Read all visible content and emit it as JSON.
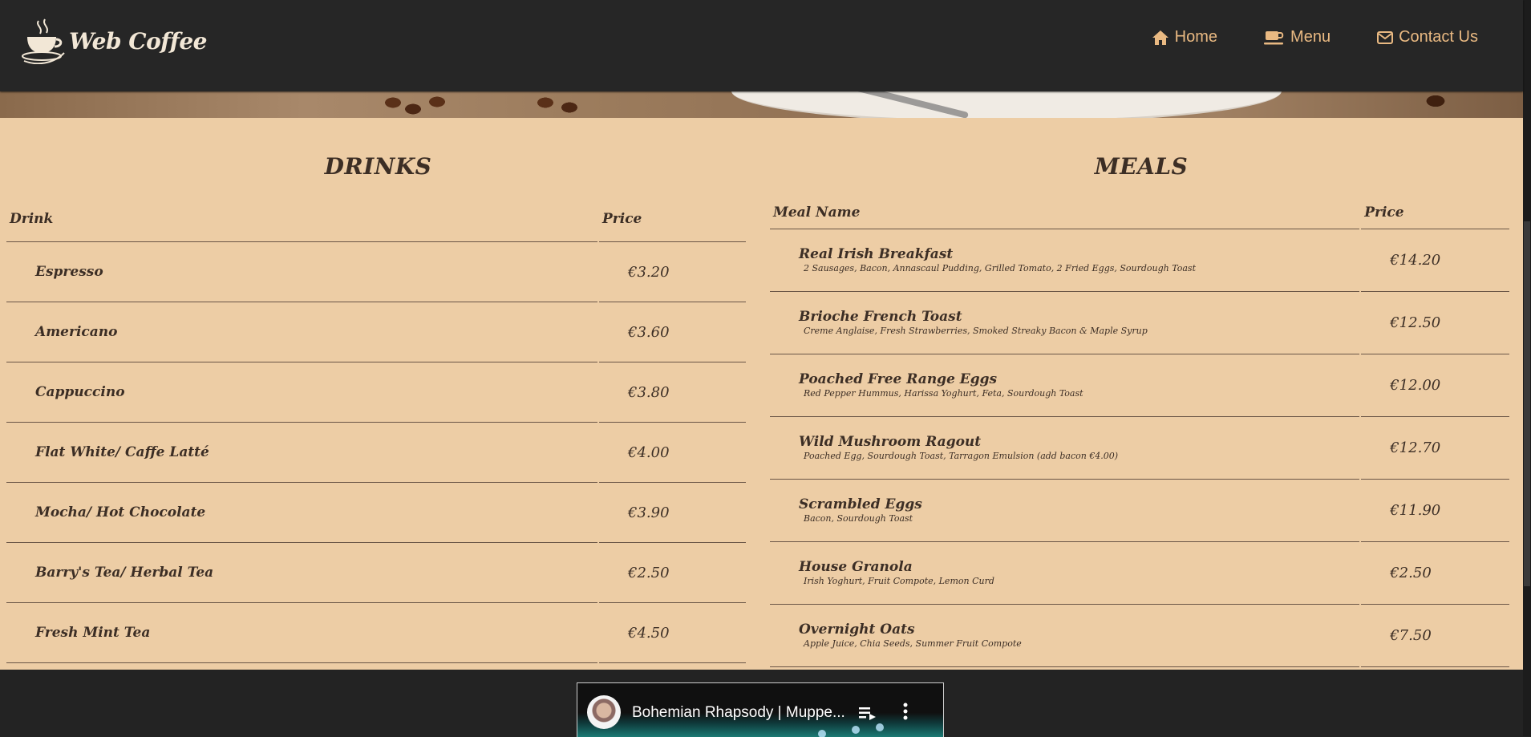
{
  "header": {
    "logo_text": "Web Coffee",
    "logo_icon": "coffee-cup-logo",
    "nav": [
      {
        "label": "Home",
        "icon": "home-icon"
      },
      {
        "label": "Menu",
        "icon": "coffee-cup-icon"
      },
      {
        "label": "Contact Us",
        "icon": "envelope-icon"
      }
    ]
  },
  "drinks": {
    "title": "DRINKS",
    "columns": [
      "Drink",
      "Price"
    ],
    "rows": [
      {
        "name": "Espresso",
        "price": "€3.20"
      },
      {
        "name": "Americano",
        "price": "€3.60"
      },
      {
        "name": "Cappuccino",
        "price": "€3.80"
      },
      {
        "name": "Flat White/ Caffe Latté",
        "price": "€4.00"
      },
      {
        "name": "Mocha/ Hot Chocolate",
        "price": "€3.90"
      },
      {
        "name": "Barry's Tea/ Herbal Tea",
        "price": "€2.50"
      },
      {
        "name": "Fresh Mint Tea",
        "price": "€4.50"
      }
    ]
  },
  "meals": {
    "title": "MEALS",
    "columns": [
      "Meal Name",
      "Price"
    ],
    "rows": [
      {
        "name": "Real Irish Breakfast",
        "desc": "2 Sausages, Bacon, Annascaul Pudding, Grilled Tomato, 2 Fried Eggs, Sourdough Toast",
        "price": "€14.20"
      },
      {
        "name": "Brioche French Toast",
        "desc": "Creme Anglaise, Fresh Strawberries, Smoked Streaky Bacon & Maple Syrup",
        "price": "€12.50"
      },
      {
        "name": "Poached Free Range Eggs",
        "desc": "Red Pepper Hummus, Harissa Yoghurt, Feta, Sourdough Toast",
        "price": "€12.00"
      },
      {
        "name": "Wild Mushroom Ragout",
        "desc": "Poached Egg, Sourdough Toast, Tarragon Emulsion (add bacon €4.00)",
        "price": "€12.70"
      },
      {
        "name": "Scrambled Eggs",
        "desc": "Bacon, Sourdough Toast",
        "price": "€11.90"
      },
      {
        "name": "House Granola",
        "desc": "Irish Yoghurt, Fruit Compote, Lemon Curd",
        "price": "€2.50"
      },
      {
        "name": "Overnight Oats",
        "desc": "Apple Juice, Chia Seeds, Summer Fruit Compote",
        "price": "€7.50"
      }
    ]
  },
  "video": {
    "title": "Bohemian Rhapsody | Muppe...",
    "playlist_icon": "playlist-icon",
    "more_icon": "more-vert-icon"
  },
  "colors": {
    "header_bg": "#262626",
    "nav_accent": "#e9b982",
    "menu_bg": "#edcda5",
    "text": "#3c2e25"
  }
}
